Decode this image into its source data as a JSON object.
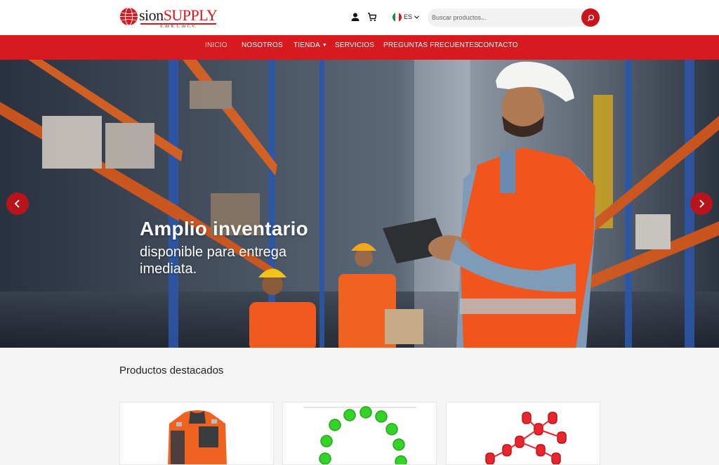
{
  "header": {
    "logo": {
      "word_dark": "sion",
      "word_red": "SUPPLY",
      "subtitle": "S. de R. L. de C.V."
    },
    "language": {
      "code": "ES"
    },
    "search": {
      "placeholder": "Buscar productos..."
    }
  },
  "nav": {
    "items": [
      {
        "label": "INICIO",
        "active": true
      },
      {
        "label": "NOSOTROS"
      },
      {
        "label": "TIENDA",
        "has_dropdown": true
      },
      {
        "label": "SERVICIOS"
      },
      {
        "label": "PREGUNTAS FRECUENTES"
      },
      {
        "label": "CONTACTO"
      }
    ]
  },
  "hero": {
    "title": "Amplio inventario",
    "subtitle": "disponible para entrega imediata."
  },
  "featured": {
    "title": "Productos destacados",
    "products": [
      {
        "image": "orange-safety-jacket"
      },
      {
        "image": "green-plastic-caps"
      },
      {
        "image": "red-plastic-caps"
      }
    ]
  },
  "colors": {
    "brand_red": "#d71920",
    "button_red": "#c8151c",
    "arrow_red": "#b7141b"
  },
  "icons": [
    "user-icon",
    "cart-icon",
    "mexico-flag-icon",
    "chevron-down-icon",
    "search-icon",
    "chevron-left-icon",
    "chevron-right-icon"
  ]
}
